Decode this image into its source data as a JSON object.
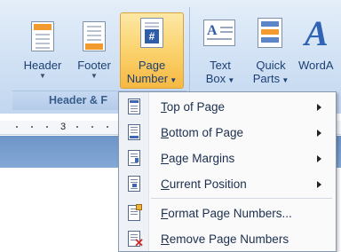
{
  "ribbon": {
    "buttons": [
      {
        "label": "Header",
        "label2": "",
        "has_arrow": true
      },
      {
        "label": "Footer",
        "label2": "",
        "has_arrow": true
      },
      {
        "label": "Page",
        "label2": "Number",
        "has_arrow": true
      },
      {
        "label": "Text",
        "label2": "Box",
        "has_arrow": true
      },
      {
        "label": "Quick",
        "label2": "Parts",
        "has_arrow": true
      },
      {
        "label": "WordA",
        "label2": "",
        "has_arrow": false
      }
    ],
    "group_label": "Header & F",
    "page_number_icon_glyph": "#",
    "wordart_glyph": "A",
    "accent_color": "#f6b842"
  },
  "ruler": {
    "number": "3"
  },
  "menu": {
    "items": [
      {
        "pre": "",
        "key": "T",
        "post": "op of Page",
        "submenu": true,
        "icon": "top-of-page-icon"
      },
      {
        "pre": "",
        "key": "B",
        "post": "ottom of Page",
        "submenu": true,
        "icon": "bottom-of-page-icon"
      },
      {
        "pre": "",
        "key": "P",
        "post": "age Margins",
        "submenu": true,
        "icon": "page-margins-icon"
      },
      {
        "pre": "",
        "key": "C",
        "post": "urrent Position",
        "submenu": true,
        "icon": "current-position-icon"
      },
      {
        "pre": "",
        "key": "F",
        "post": "ormat Page Numbers...",
        "submenu": false,
        "icon": "format-page-numbers-icon"
      },
      {
        "pre": "",
        "key": "R",
        "post": "emove Page Numbers",
        "submenu": false,
        "icon": "remove-page-numbers-icon"
      }
    ]
  }
}
